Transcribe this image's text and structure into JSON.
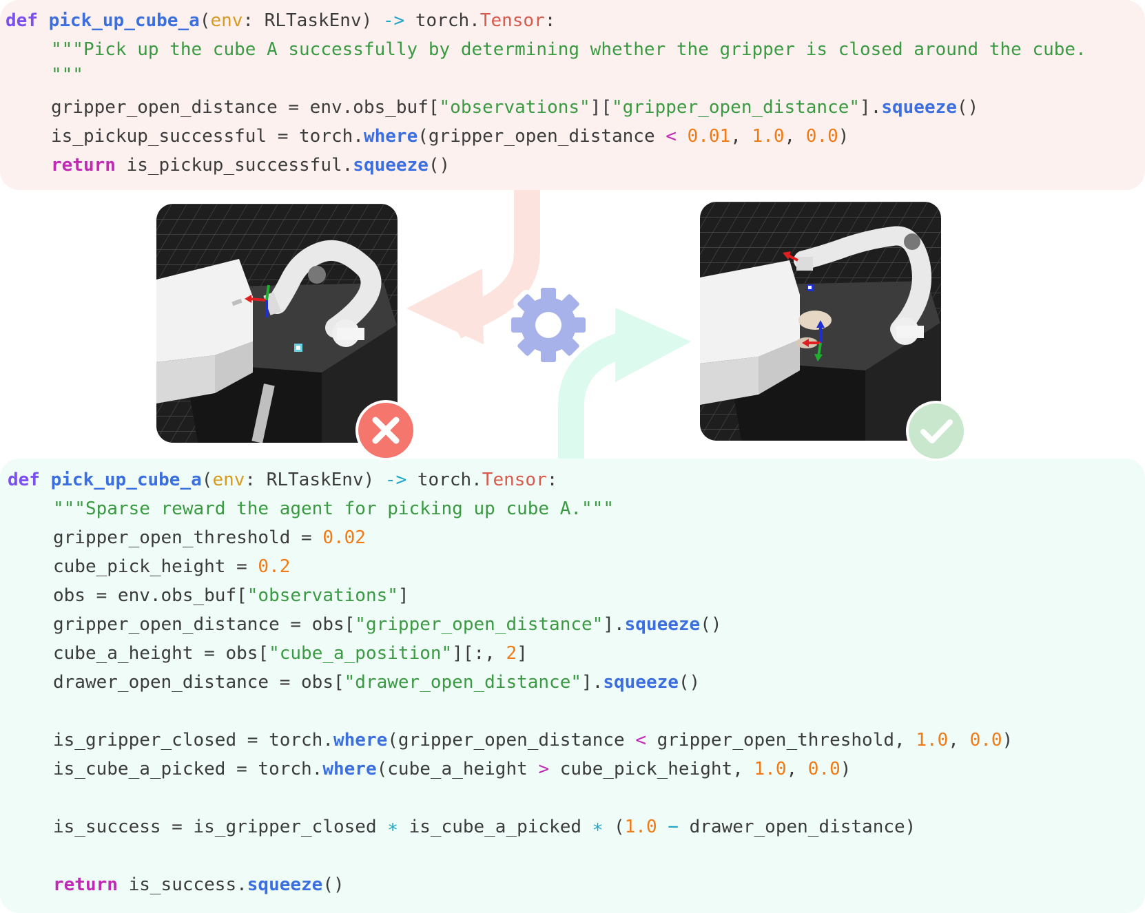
{
  "top_code": {
    "line1": {
      "def": "def",
      "name": "pick_up_cube_a",
      "open": "(",
      "param": "env",
      "colon": ": RLTaskEnv) ",
      "arrow": "->",
      "torch": " torch.",
      "type": "Tensor",
      "end": ":"
    },
    "line2": "\"\"\"Pick up the cube A successfully by determining whether the gripper is closed around the cube.",
    "line3": "\"\"\"",
    "line4": {
      "a": "gripper_open_distance = env.obs_buf[",
      "s1": "\"observations\"",
      "b": "][",
      "s2": "\"gripper_open_distance\"",
      "c": "].",
      "m": "squeeze",
      "d": "()"
    },
    "line5": {
      "a": "is_pickup_successful = torch.",
      "m": "where",
      "b": "(gripper_open_distance ",
      "lt": "<",
      "n1": "0.01",
      "comma1": ", ",
      "n2": "1.0",
      "comma2": ", ",
      "n3": "0.0",
      "c": ")"
    },
    "line6": {
      "ret": "return",
      "a": " is_pickup_successful.",
      "m": "squeeze",
      "b": "()"
    }
  },
  "bottom_code": {
    "line1": {
      "def": "def",
      "name": "pick_up_cube_a",
      "open": "(",
      "param": "env",
      "colon": ": RLTaskEnv) ",
      "arrow": "->",
      "torch": " torch.",
      "type": "Tensor",
      "end": ":"
    },
    "line2": "\"\"\"Sparse reward the agent for picking up cube A.\"\"\"",
    "line3": {
      "a": "gripper_open_threshold = ",
      "n": "0.02"
    },
    "line4": {
      "a": "cube_pick_height = ",
      "n": "0.2"
    },
    "line5": {
      "a": "obs = env.obs_buf[",
      "s": "\"observations\"",
      "b": "]"
    },
    "line6": {
      "a": "gripper_open_distance = obs[",
      "s": "\"gripper_open_distance\"",
      "b": "].",
      "m": "squeeze",
      "c": "()"
    },
    "line7": {
      "a": "cube_a_height = obs[",
      "s": "\"cube_a_position\"",
      "b": "][:, ",
      "n": "2",
      "c": "]"
    },
    "line8": {
      "a": "drawer_open_distance = obs[",
      "s": "\"drawer_open_distance\"",
      "b": "].",
      "m": "squeeze",
      "c": "()"
    },
    "line9": {
      "a": "is_gripper_closed = torch.",
      "m": "where",
      "b": "(gripper_open_distance ",
      "lt": "<",
      "c": " gripper_open_threshold, ",
      "n1": "1.0",
      "comma": ", ",
      "n2": "0.0",
      "d": ")"
    },
    "line10": {
      "a": "is_cube_a_picked = torch.",
      "m": "where",
      "b": "(cube_a_height ",
      "gt": ">",
      "c": " cube_pick_height, ",
      "n1": "1.0",
      "comma": ", ",
      "n2": "0.0",
      "d": ")"
    },
    "line11": {
      "a": "is_success = is_gripper_closed ",
      "star1": "∗",
      "b": " is_cube_a_picked ",
      "star2": "∗",
      "c": " (",
      "n": "1.0",
      "sp": " ",
      "minus": "−",
      "d": " drawer_open_distance)"
    },
    "line12": {
      "ret": "return",
      "a": " is_success.",
      "m": "squeeze",
      "b": "()"
    }
  },
  "icons": {
    "gear": "gear-icon",
    "fail": "cross-icon",
    "success": "check-icon",
    "arrow_down": "curved-arrow-left-icon",
    "arrow_up": "curved-arrow-right-icon"
  },
  "colors": {
    "top_panel_bg": "#fdf1ef",
    "bottom_panel_bg": "#effcf7",
    "fail_badge": "#f4766d",
    "success_badge": "#c9e7cc",
    "gear": "#a7b1ea",
    "arrow_down": "#fde3de",
    "arrow_up": "#dcfaee"
  }
}
